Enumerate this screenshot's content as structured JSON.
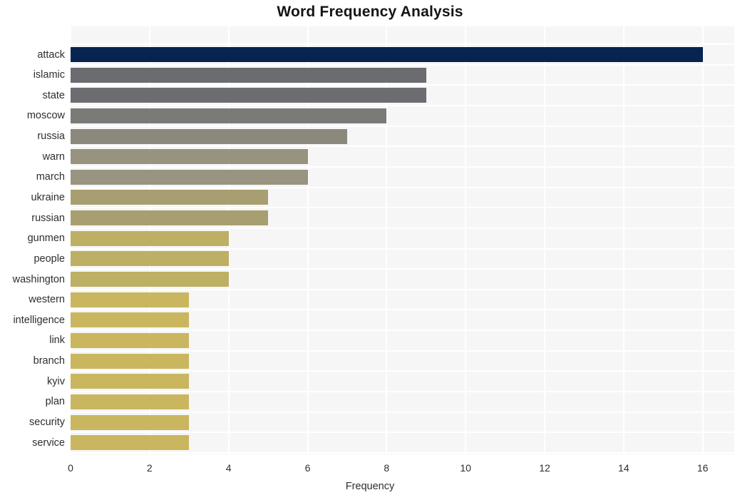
{
  "chart_data": {
    "type": "bar",
    "orientation": "horizontal",
    "title": "Word Frequency Analysis",
    "xlabel": "Frequency",
    "ylabel": "",
    "categories": [
      "attack",
      "islamic",
      "state",
      "moscow",
      "russia",
      "warn",
      "march",
      "ukraine",
      "russian",
      "gunmen",
      "people",
      "washington",
      "western",
      "intelligence",
      "link",
      "branch",
      "kyiv",
      "plan",
      "security",
      "service"
    ],
    "values": [
      16,
      9,
      9,
      8,
      7,
      6,
      6,
      5,
      5,
      4,
      4,
      4,
      3,
      3,
      3,
      3,
      3,
      3,
      3,
      3
    ],
    "xlim": [
      0,
      16.8
    ],
    "xticks": [
      "0",
      "2",
      "4",
      "6",
      "8",
      "10",
      "12",
      "14",
      "16"
    ],
    "xtick_values": [
      0,
      2,
      4,
      6,
      8,
      10,
      12,
      14,
      16
    ],
    "grid": true,
    "grid_color": "#ffffff",
    "plot_background": "#f6f6f6",
    "figure_background": "#ffffff",
    "legend": "none",
    "bar_colors": [
      "#06244f",
      "#6b6c70",
      "#6c6d71",
      "#7a7a77",
      "#8a897c",
      "#979380",
      "#989481",
      "#a79f71",
      "#a89f70",
      "#bdaf64",
      "#bdaf64",
      "#bdaf64",
      "#c9b65f",
      "#c9b65f",
      "#c9b65f",
      "#c9b65f",
      "#c9b65f",
      "#c9b65f",
      "#c9b65f",
      "#c9b65f"
    ]
  }
}
